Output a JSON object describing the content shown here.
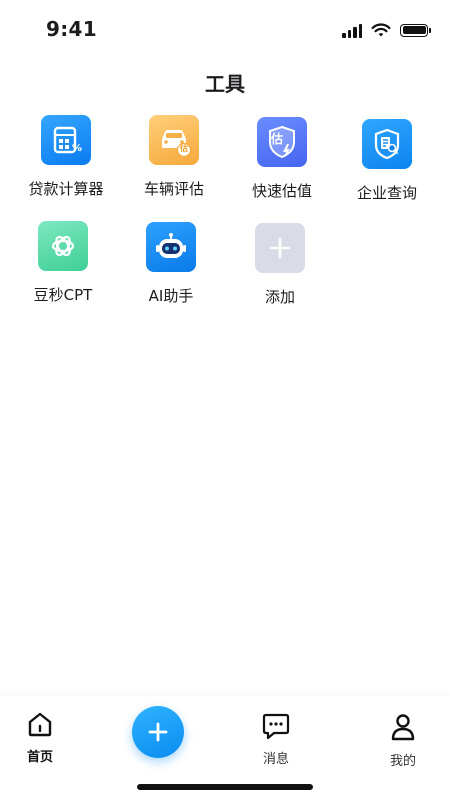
{
  "status_bar": {
    "time": "9:41"
  },
  "page": {
    "title": "工具"
  },
  "tools": [
    {
      "label": "贷款计算器",
      "icon": "calculator-icon",
      "color": "#1a8df5"
    },
    {
      "label": "车辆评估",
      "icon": "car-estimate-icon",
      "color": "#f7b24a"
    },
    {
      "label": "快速估值",
      "icon": "quick-valuation-icon",
      "color": "#5577f5"
    },
    {
      "label": "企业查询",
      "icon": "company-search-icon",
      "color": "#1190f5"
    },
    {
      "label": "豆秒CPT",
      "icon": "openai-knot-icon",
      "color": "#55d9a6"
    },
    {
      "label": "AI助手",
      "icon": "robot-icon",
      "color": "#1a8af0"
    },
    {
      "label": "添加",
      "icon": "plus-icon",
      "color": "#d9dbe6"
    }
  ],
  "badges": {
    "estimate": "估"
  },
  "bottom_nav": {
    "home": "首页",
    "messages": "消息",
    "profile": "我的",
    "add": "add-icon"
  }
}
